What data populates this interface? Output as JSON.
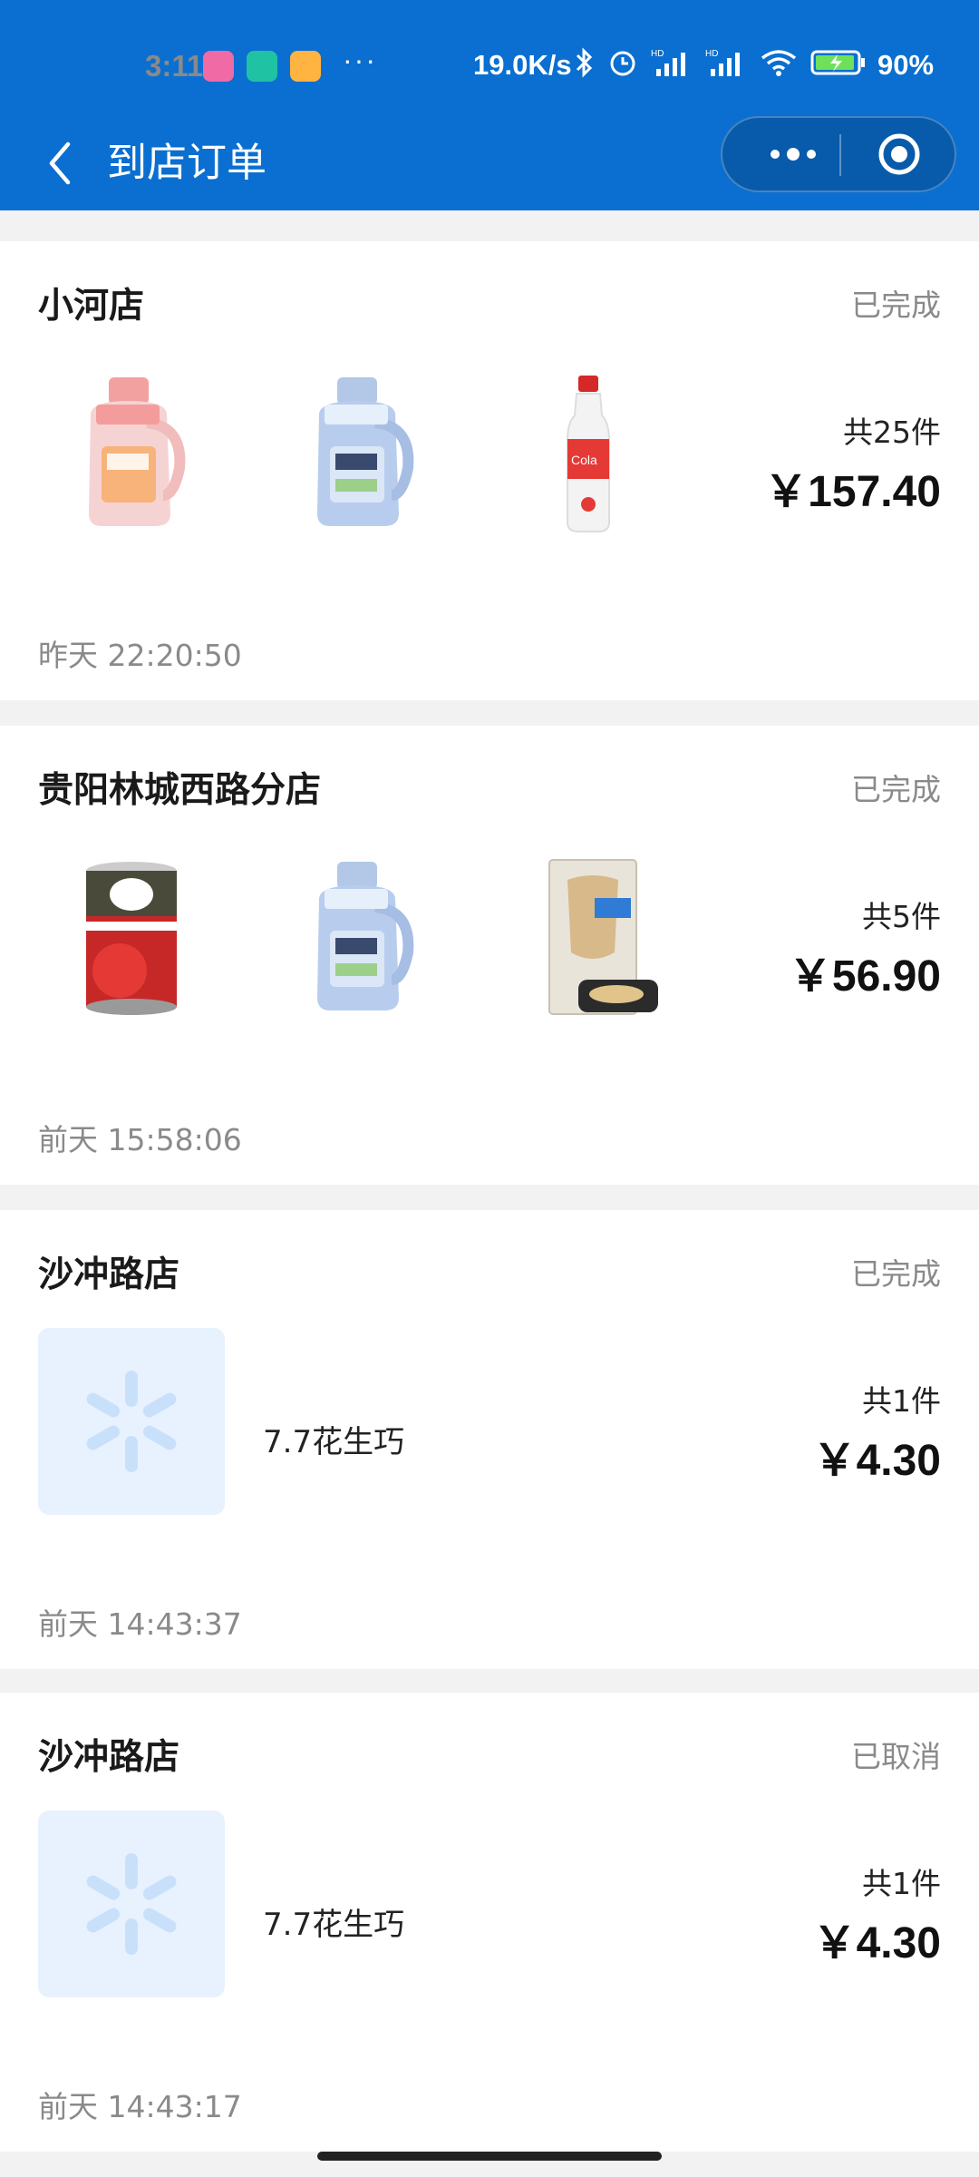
{
  "status_bar": {
    "time": "3:11",
    "more": "···",
    "net_speed": "19.0K/s",
    "battery": "90%",
    "icons": [
      "bluetooth-icon",
      "alarm-icon",
      "signal-hd-icon",
      "signal-hd-icon",
      "wifi-icon",
      "battery-charging-icon"
    ]
  },
  "nav": {
    "title": "到店订单",
    "back_icon": "back-arrow-icon",
    "more_icon": "more-dots-icon",
    "close_icon": "target-close-icon"
  },
  "orders": [
    {
      "store": "小河店",
      "status": "已完成",
      "products": [
        "pink-detergent-bottle",
        "blue-detergent-bottle",
        "cola-bottle"
      ],
      "count": "共25件",
      "price": "￥157.40",
      "time": "昨天 22:20:50"
    },
    {
      "store": "贵阳林城西路分店",
      "status": "已完成",
      "products": [
        "tomato-can",
        "blue-detergent-bottle",
        "dried-fish-pack"
      ],
      "count": "共5件",
      "price": "￥56.90",
      "time": "前天 15:58:06"
    },
    {
      "store": "沙冲路店",
      "status": "已完成",
      "item_name": "7.7花生巧",
      "count": "共1件",
      "price": "￥4.30",
      "time": "前天 14:43:37"
    },
    {
      "store": "沙冲路店",
      "status": "已取消",
      "item_name": "7.7花生巧",
      "count": "共1件",
      "price": "￥4.30",
      "time": "前天 14:43:17"
    }
  ],
  "colors": {
    "header": "#0a6fd0",
    "page_bg": "#f2f2f2",
    "placeholder_bg": "#e7f2fe",
    "placeholder_icon": "#c9e0fb"
  }
}
